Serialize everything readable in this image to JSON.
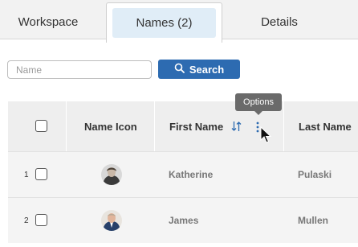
{
  "tabs": {
    "workspace": "Workspace",
    "names": "Names (2)",
    "details": "Details"
  },
  "search": {
    "placeholder": "Name",
    "value": "",
    "button_label": "Search"
  },
  "table": {
    "columns": {
      "name_icon": "Name Icon",
      "first_name": "First Name",
      "last_name": "Last Name"
    },
    "tooltip": "Options",
    "rows": [
      {
        "num": "1",
        "first_name": "Katherine",
        "last_name": "Pulaski"
      },
      {
        "num": "2",
        "first_name": "James",
        "last_name": "Mullen"
      }
    ]
  },
  "colors": {
    "accent": "#2d6bb1",
    "active_tab": "#e0edf7",
    "sort_icon": "#2d6bb1"
  },
  "icons": [
    "search-icon",
    "sort-icon",
    "options-kebab-icon",
    "mouse-cursor-icon"
  ]
}
